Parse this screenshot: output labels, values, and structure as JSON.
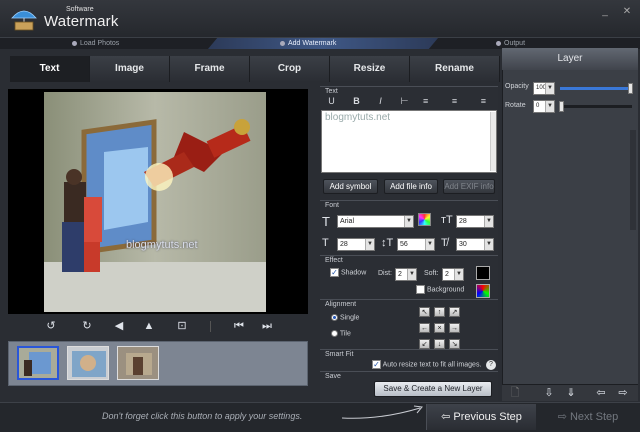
{
  "app": {
    "brand_small": "Software",
    "brand_big": "Watermark",
    "min": "_",
    "close": "✕"
  },
  "steps": [
    "Load Photos",
    "Add Watermark",
    "Output"
  ],
  "tabs": [
    "Text",
    "Image",
    "Frame",
    "Crop",
    "Resize",
    "Rename"
  ],
  "preview": {
    "watermark_text": "blogmytuts.net"
  },
  "text_section": {
    "title": "Text",
    "format_buttons": [
      "U",
      "B",
      "I",
      "⊢",
      "≡",
      "≡",
      "≡"
    ],
    "value": "blogmytuts.net",
    "buttons": [
      "Add symbol",
      "Add file info",
      "Add EXIF info"
    ]
  },
  "font": {
    "title": "Font",
    "family": "Arial",
    "size": "28",
    "width": "28",
    "height": "56",
    "angle": "30"
  },
  "effect": {
    "title": "Effect",
    "shadow_label": "Shadow",
    "dist_label": "Dist:",
    "dist": "2",
    "soft_label": "Soft:",
    "soft": "2",
    "background_label": "Background"
  },
  "alignment": {
    "title": "Alignment",
    "single": "Single",
    "tile": "Tile"
  },
  "smart_fit": {
    "title": "Smart Fit",
    "label": "Auto resize text to fit all images."
  },
  "save": {
    "title": "Save",
    "button": "Save & Create a New Layer"
  },
  "layer": {
    "title": "Layer",
    "opacity_label": "Opacity",
    "opacity": "100",
    "rotate_label": "Rotate",
    "rotate": "0",
    "opacity_fraction": 1.0
  },
  "footer": {
    "hint": "Don't forget click this button to apply your settings.",
    "prev": "Previous Step",
    "next": "Next Step"
  }
}
